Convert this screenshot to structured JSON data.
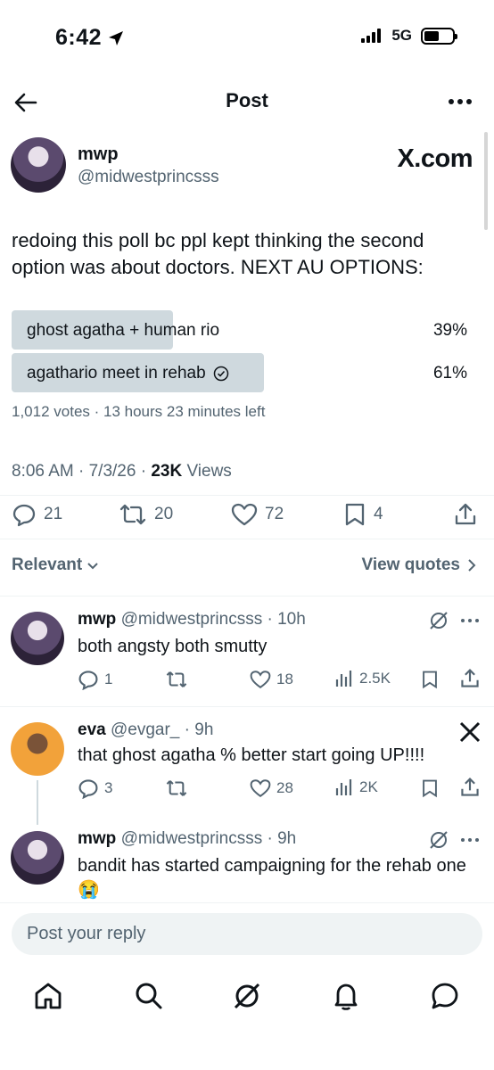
{
  "status_bar": {
    "time": "6:42",
    "network": "5G"
  },
  "header": {
    "title": "Post"
  },
  "tweet": {
    "name": "mwp",
    "handle": "@midwestprincsss",
    "watermark": "X.com",
    "text": "redoing this poll bc ppl kept thinking the second option was about doctors. NEXT AU OPTIONS:",
    "poll": {
      "options": [
        {
          "label": "ghost agatha + human rio",
          "percent": "39%",
          "share": 0.39
        },
        {
          "label": "agathario meet in rehab",
          "percent": "61%",
          "share": 0.61
        }
      ],
      "meta": "1,012 votes · 13 hours 23 minutes left"
    },
    "timestamp": "8:06 AM · 7/3/26 · ",
    "views_count": "23K",
    "views_label": " Views",
    "actions": {
      "replies": "21",
      "reposts": "20",
      "likes": "72",
      "bookmarks": "4"
    }
  },
  "sort": {
    "relevant": "Relevant",
    "view_quotes": "View quotes"
  },
  "replies": [
    {
      "name": "mwp",
      "handle": "@midwestprincsss · 10h",
      "text": "both angsty both smutty",
      "replies": "1",
      "reposts": "",
      "likes": "18",
      "views": "2.5K"
    },
    {
      "name": "eva",
      "handle": "@evgar_ · 9h",
      "text": "that ghost agatha % better start going UP!!!!",
      "replies": "3",
      "reposts": "",
      "likes": "28",
      "views": "2K"
    },
    {
      "name": "mwp",
      "handle": "@midwestprincsss · 9h",
      "text": "bandit has started campaigning for the rehab one😭"
    }
  ],
  "composer": {
    "placeholder": "Post your reply"
  },
  "tabs": [
    "home-icon",
    "search-icon",
    "grok-icon",
    "notifications-icon",
    "messages-icon"
  ],
  "colors": {
    "text": "#0f1419",
    "muted": "#536471",
    "poll_bar": "#cfd9de"
  }
}
